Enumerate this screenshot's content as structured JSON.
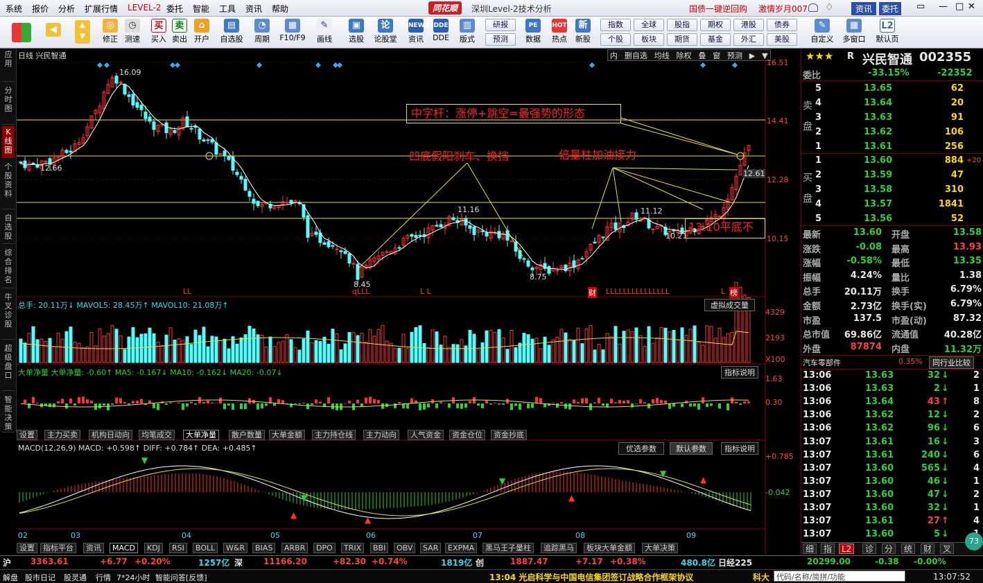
{
  "menu": {
    "items": [
      "系统",
      "报价",
      "分析",
      "扩展行情",
      "LEVEL-2",
      "委托",
      "智能",
      "工具",
      "资讯",
      "帮助"
    ],
    "logo": "同花顺",
    "title": "深圳Level-2技术分析",
    "promo1": "国债一键逆回购",
    "promo2": "激情岁月007",
    "login": "资讯",
    "trade": "委托"
  },
  "toolbar": {
    "tools": [
      "修正",
      "测速",
      "买入",
      "卖出",
      "开户",
      "自选股",
      "周期",
      "F10/F9",
      "画线",
      "选股",
      "论股堂",
      "资讯",
      "DDE",
      "版式",
      "数据",
      "热点",
      "新股",
      "自定义",
      "多窗口",
      "默认页"
    ],
    "small_buttons": [
      "研报",
      "预测",
      "指数",
      "全球",
      "股指",
      "期权",
      "港股",
      "债券",
      "个股",
      "板块",
      "期货",
      "基金",
      "外汇",
      "美股"
    ]
  },
  "leftnav": [
    "应用",
    "分时图",
    "K线图",
    "个股资料",
    "自选股",
    "综合排名",
    "牛叉诊股",
    "超级盘口",
    "智能决策"
  ],
  "kline": {
    "title": "日线 兴民智通",
    "options": [
      "内",
      "删自选",
      "均线",
      "除权",
      "叠",
      "窗",
      "预测"
    ],
    "yaxis": [
      "16.51",
      "14.41",
      "12.28",
      "10.15"
    ],
    "marks": [
      "16.09",
      "12.66",
      "11.16",
      "8.45",
      "11.12",
      "8.75",
      "10.21",
      "12.61"
    ],
    "ann1": "中字杆：涨停+跳空=最强势的形态",
    "ann2": "凹底假阳刹车、换挡",
    "ann3": "倍量柱加油接力",
    "ann4": "13.10平底不",
    "signals": [
      "LL",
      "qLLL",
      "L L",
      "财",
      "LLLLLLLLLLLLLLL",
      "L",
      "榜"
    ]
  },
  "volume": {
    "label": "总手: 20.11万↓ MAVOL5: 28.45万↑ MAVOL10: 21.08万↑",
    "btn": "虚拟成交量",
    "yaxis": [
      "4329",
      "2193",
      "X100"
    ]
  },
  "bigorder": {
    "label": "大单净量 大单净量: -0.60↑ MA5: -0.167↓ MA10: -0.162↓ MA20: -0.07↓",
    "btn": "指标说明",
    "yaxis": [
      "1.63",
      "0.30"
    ],
    "tabs": [
      "设置",
      "主力买卖",
      "机构日动向",
      "均笔成交",
      "大单净量",
      "散户数量",
      "大单金额",
      "主力持仓线",
      "主力动向",
      "人气资金",
      "资金仓位",
      "资金抄底"
    ]
  },
  "macd": {
    "label": "MACD(12,26,9) MACD: +0.598↑ DIFF: +0.784↑ DEA: +0.485↑",
    "btns": [
      "优选参数",
      "默认参数",
      "指标说明"
    ],
    "yaxis": [
      "+0.785",
      "-0.042"
    ],
    "months": [
      "02",
      "03",
      "04",
      "05",
      "06",
      "07",
      "08",
      "09"
    ],
    "tabs": [
      "设置",
      "指标平台",
      "资讯",
      "MACD",
      "KDJ",
      "RSI",
      "BOLL",
      "W&R",
      "BIAS",
      "ARBR",
      "DPO",
      "TRIX",
      "BBI",
      "OBV",
      "SAR",
      "EXPMA",
      "黑马王子量柱",
      "追踪黑马",
      "板块大单金额",
      "大单决策"
    ]
  },
  "quote": {
    "name": "兴民智通",
    "code": "002355",
    "rating": "R",
    "weibi": "委比",
    "weibi_v": "-33.15%",
    "weicha": "-22352",
    "sell": [
      [
        "5",
        "13.65",
        "62"
      ],
      [
        "4",
        "13.64",
        "20"
      ],
      [
        "3",
        "13.63",
        "91"
      ],
      [
        "2",
        "13.62",
        "106"
      ],
      [
        "1",
        "13.61",
        "256"
      ]
    ],
    "buy": [
      [
        "1",
        "13.60",
        "884",
        "+20"
      ],
      [
        "2",
        "13.59",
        "47",
        ""
      ],
      [
        "3",
        "13.58",
        "310",
        ""
      ],
      [
        "4",
        "13.57",
        "1841",
        ""
      ],
      [
        "5",
        "13.56",
        "52",
        ""
      ]
    ],
    "sell_label": "卖盘",
    "buy_label": "买盘",
    "stats": [
      [
        "最新",
        "13.60",
        "开盘",
        "13.58"
      ],
      [
        "涨跌",
        "-0.08",
        "最高",
        "13.93"
      ],
      [
        "涨幅",
        "-0.58%",
        "最低",
        "13.35"
      ],
      [
        "振幅",
        "4.24%",
        "量比",
        "1.38"
      ],
      [
        "总手",
        "20.11万",
        "换手",
        "6.79%"
      ],
      [
        "金额",
        "2.73亿",
        "换手(实)",
        "6.79%"
      ],
      [
        "市盈",
        "137.5",
        "市盈(动)",
        "87.32"
      ],
      [
        "总市值",
        "69.86亿",
        "流通值",
        "40.28亿"
      ],
      [
        "外盘",
        "87874",
        "内盘",
        "11.32万"
      ]
    ],
    "industry": "汽车零部件",
    "industry_pct": "0.35%",
    "industry_btn": "同行业比较",
    "ticks": [
      [
        "13:06",
        "13.63",
        "32",
        "↓",
        "2"
      ],
      [
        "13:06",
        "13.63",
        "2",
        "↓",
        "1"
      ],
      [
        "13:06",
        "13.64",
        "43",
        "↑",
        "8"
      ],
      [
        "13:06",
        "13.62",
        "12",
        "↓",
        "2"
      ],
      [
        "13:06",
        "13.62",
        "96",
        "↓",
        "6"
      ],
      [
        "13:07",
        "13.61",
        "16",
        "↓",
        "3"
      ],
      [
        "13:07",
        "13.61",
        "240",
        "↓",
        "6"
      ],
      [
        "13:07",
        "13.60",
        "565",
        "↓",
        "4"
      ],
      [
        "13:07",
        "13.60",
        "46",
        "↓",
        "1"
      ],
      [
        "13:07",
        "13.60",
        "47",
        "↓",
        "2"
      ],
      [
        "13:07",
        "13.60",
        "32",
        "↓",
        "1"
      ],
      [
        "13:07",
        "13.61",
        "27",
        "↑",
        "4"
      ],
      [
        "13:07",
        "13.60",
        "5",
        "↓",
        "1"
      ]
    ],
    "tabs": [
      "细",
      "指",
      "L2",
      "诊",
      "分",
      "统",
      "财",
      "叉"
    ]
  },
  "status": {
    "sh_label": "沪",
    "sh": "3363.61",
    "sh_chg": "+6.77",
    "sh_pct": "+0.20%",
    "sh_amt": "1257亿",
    "sz_label": "深",
    "sz": "11166.20",
    "sz_chg": "+82.30",
    "sz_pct": "+0.74%",
    "sz_amt": "1819亿",
    "cy_label": "创",
    "cy": "1887.47",
    "cy_chg": "+7.17",
    "cy_pct": "+0.38%",
    "cy_amt": "480.8亿",
    "rj_label": "日经225",
    "rj": "20299.00",
    "rj_chg": "-0.38",
    "rj_pct": "-0.00%",
    "bottom": [
      "解盘",
      "股市日记",
      "股灵通",
      "行情",
      "7*24小时",
      "智能问答[反馈]"
    ],
    "news": "13:04 光启科学与中国电信集团签订战略合作框架协议",
    "kd": "科大",
    "search": "代码/名称/简拼/功能",
    "clock": "13:07:52",
    "badge": "73"
  }
}
